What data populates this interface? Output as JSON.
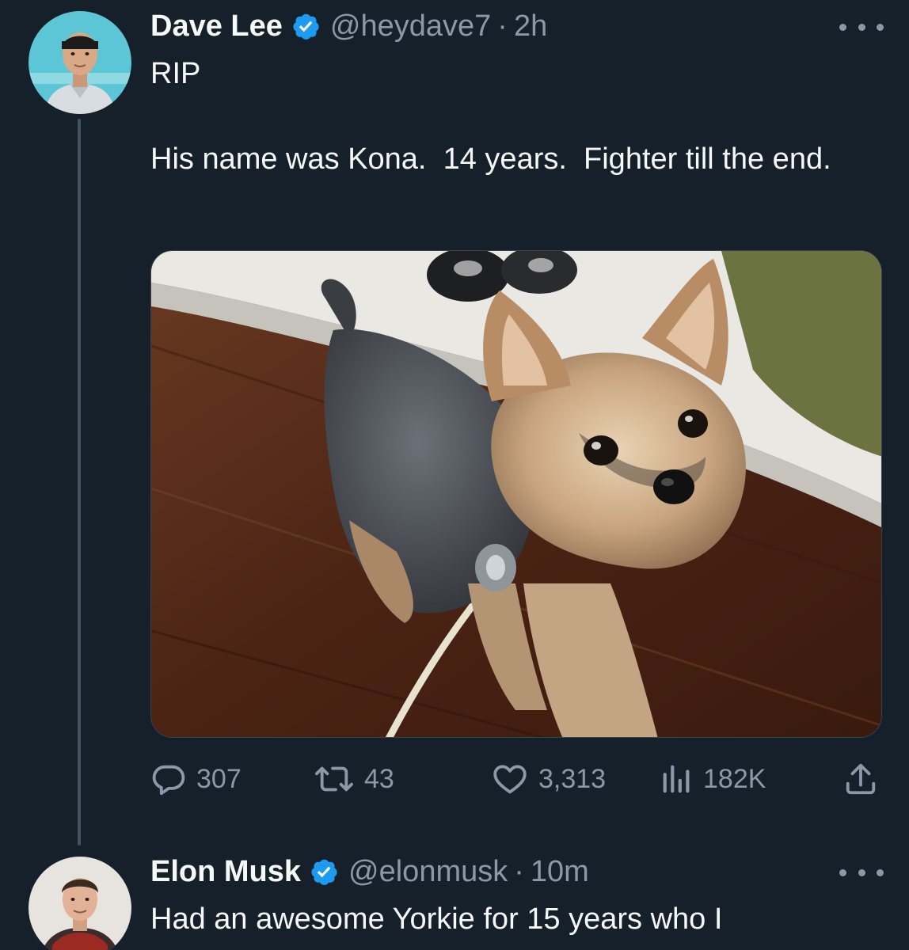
{
  "tweets": [
    {
      "author": {
        "name": "Dave Lee",
        "handle": "@heydave7",
        "verified": true
      },
      "time": "2h",
      "separator": "·",
      "text": "RIP\n\nHis name was Kona.  14 years.  Fighter till the end.",
      "media": {
        "type": "photo",
        "alt_subject": "yorkshire terrier on wooden floor"
      },
      "stats": {
        "replies": "307",
        "retweets": "43",
        "likes": "3,313",
        "views": "182K"
      }
    },
    {
      "author": {
        "name": "Elon Musk",
        "handle": "@elonmusk",
        "verified": true
      },
      "time": "10m",
      "separator": "·",
      "text": "Had an awesome Yorkie for 15 years who I"
    }
  ],
  "icons": {
    "verified_badge": "verified-badge-icon",
    "more": "more-icon",
    "reply": "reply-icon",
    "retweet": "retweet-icon",
    "like": "like-icon",
    "views": "views-icon",
    "share": "share-icon"
  },
  "colors": {
    "background": "#15202b",
    "primary_text": "#f7f9f9",
    "secondary_text": "#8b98a5",
    "verified_blue": "#1d9bf0",
    "thread_line": "#425364"
  }
}
